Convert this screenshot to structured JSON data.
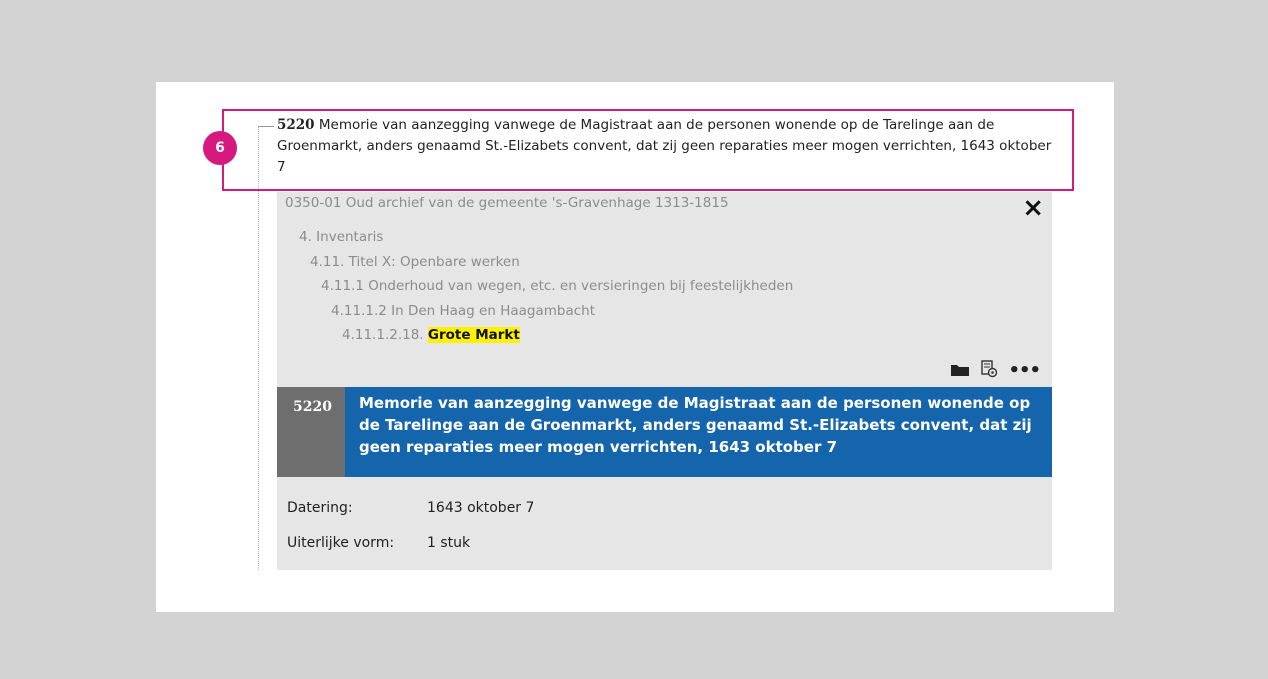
{
  "callout": {
    "badge": "6"
  },
  "record": {
    "number": "5220",
    "title": "Memorie van aanzegging vanwege de Magistraat aan de personen wonende op de Tarelinge aan de Groenmarkt, anders genaamd St.-Elizabets convent, dat zij geen reparaties meer mogen verrichten, 1643 oktober 7"
  },
  "panel": {
    "archive": "0350-01 Oud archief van de gemeente 's-Gravenhage 1313-1815",
    "close_icon": "×",
    "tree": [
      {
        "label": "4. Inventaris"
      },
      {
        "label": "4.11. Titel X: Openbare werken"
      },
      {
        "label": "4.11.1 Onderhoud van wegen, etc. en versieringen bij feestelijkheden"
      },
      {
        "label": "4.11.1.2 In Den Haag en Haagambacht"
      },
      {
        "prefix": "4.11.1.2.18.",
        "highlight": "Grote Markt"
      }
    ],
    "icons": [
      "folder-icon",
      "document-gear-icon",
      "more-icon"
    ],
    "more_label": "•••",
    "blue_row": {
      "number": "5220",
      "title": "Memorie van aanzegging vanwege de Magistraat aan de personen wonende op de Tarelinge aan de Groenmarkt, anders genaamd St.-Elizabets convent, dat zij geen reparaties meer mogen verrichten, 1643 oktober 7"
    },
    "meta": [
      {
        "label": "Datering:",
        "value": "1643 oktober 7"
      },
      {
        "label": "Uiterlijke vorm:",
        "value": "1 stuk"
      }
    ]
  },
  "colors": {
    "magenta": "#d6187f",
    "blue": "#1565ad",
    "highlight": "#fff200"
  }
}
